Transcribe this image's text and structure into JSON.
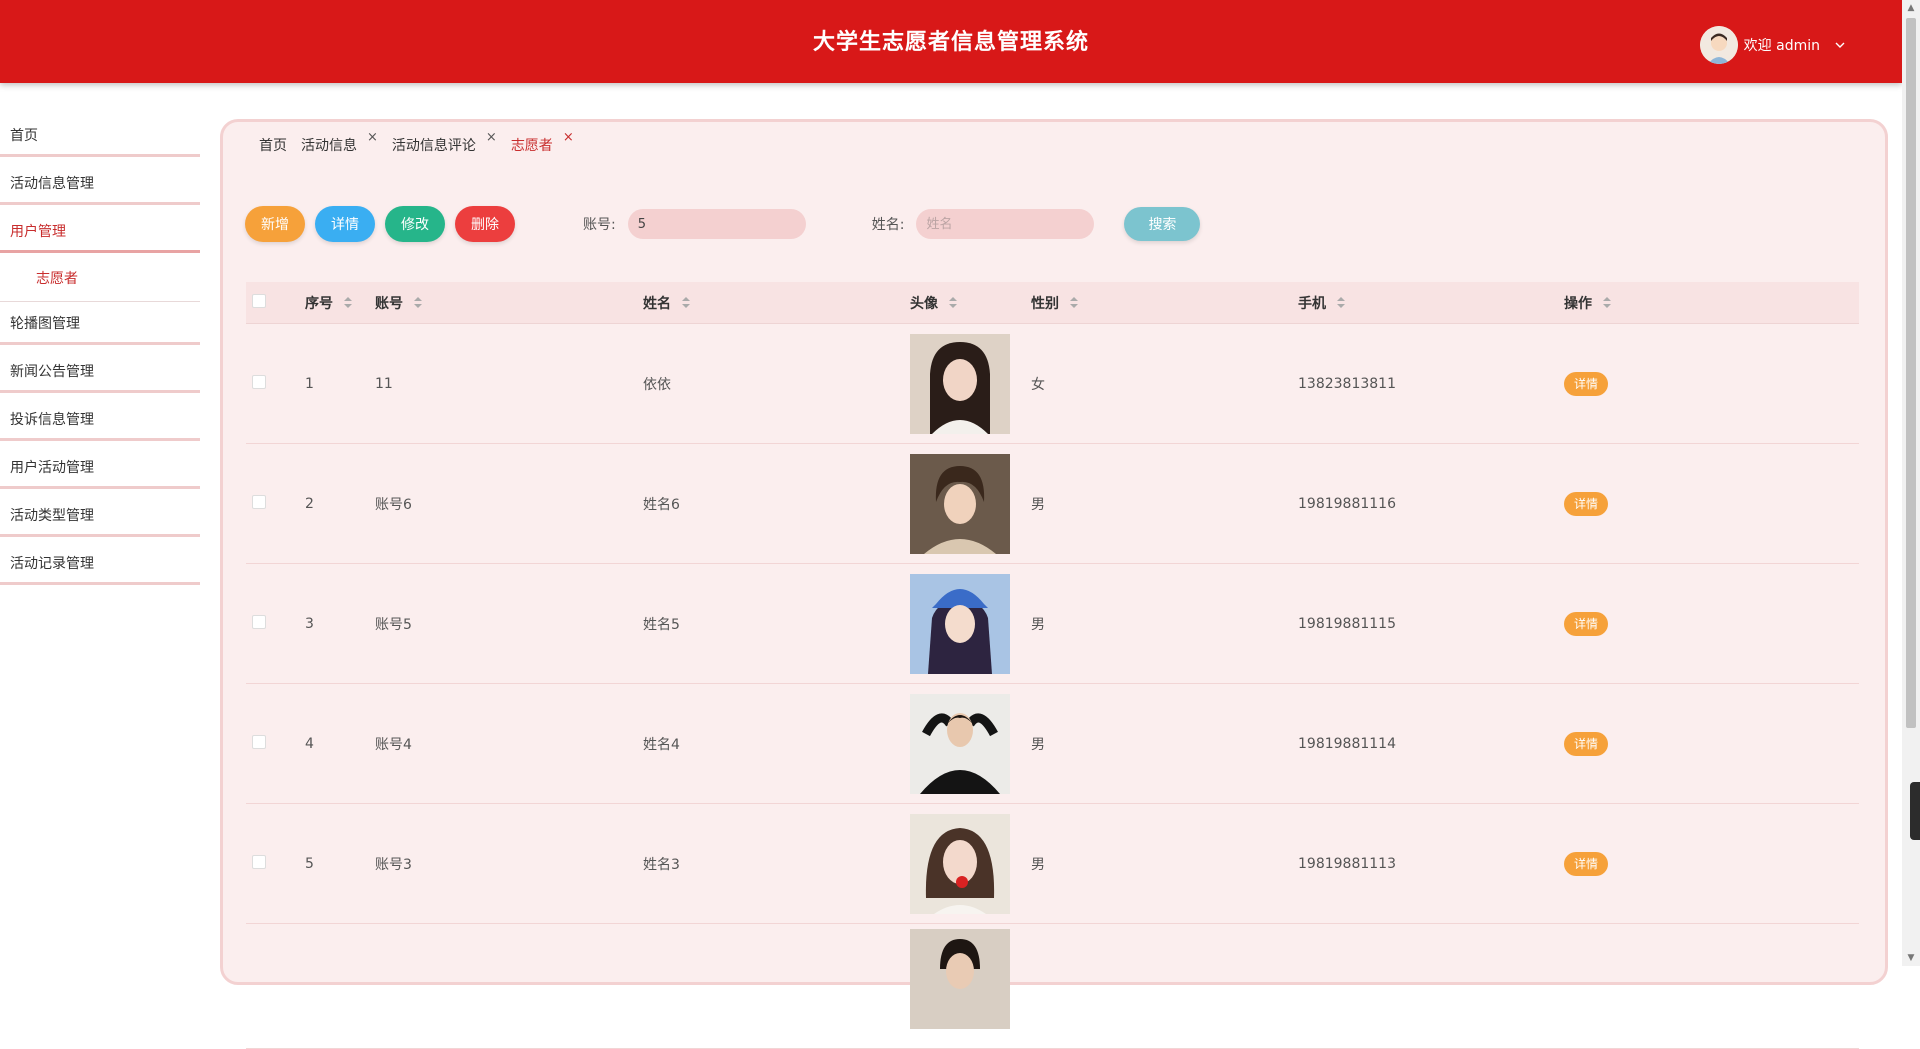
{
  "header": {
    "title": "大学生志愿者信息管理系统",
    "greeting": "欢迎 admin"
  },
  "sidebar": {
    "items": [
      {
        "label": "首页"
      },
      {
        "label": "活动信息管理"
      },
      {
        "label": "用户管理"
      },
      {
        "label": "志愿者"
      },
      {
        "label": "轮播图管理"
      },
      {
        "label": "新闻公告管理"
      },
      {
        "label": "投诉信息管理"
      },
      {
        "label": "用户活动管理"
      },
      {
        "label": "活动类型管理"
      },
      {
        "label": "活动记录管理"
      }
    ]
  },
  "tabs": [
    {
      "label": "首页"
    },
    {
      "label": "活动信息",
      "close": "×"
    },
    {
      "label": "活动信息评论",
      "close": "×"
    },
    {
      "label": "志愿者",
      "close": "×"
    }
  ],
  "toolbar": {
    "add_label": "新增",
    "detail_label": "详情",
    "edit_label": "修改",
    "delete_label": "删除",
    "account_label": "账号:",
    "account_value": "5",
    "name_label": "姓名:",
    "name_placeholder": "姓名",
    "search_label": "搜索"
  },
  "table": {
    "headers": {
      "seq": "序号",
      "account": "账号",
      "name": "姓名",
      "avatar": "头像",
      "gender": "性别",
      "phone": "手机",
      "action": "操作"
    },
    "rows": [
      {
        "seq": "1",
        "account": "11",
        "name": "依依",
        "gender": "女",
        "phone": "13823813811",
        "action": "详情"
      },
      {
        "seq": "2",
        "account": "账号6",
        "name": "姓名6",
        "gender": "男",
        "phone": "19819881116",
        "action": "详情"
      },
      {
        "seq": "3",
        "account": "账号5",
        "name": "姓名5",
        "gender": "男",
        "phone": "19819881115",
        "action": "详情"
      },
      {
        "seq": "4",
        "account": "账号4",
        "name": "姓名4",
        "gender": "男",
        "phone": "19819881114",
        "action": "详情"
      },
      {
        "seq": "5",
        "account": "账号3",
        "name": "姓名3",
        "gender": "男",
        "phone": "19819881113",
        "action": "详情"
      }
    ]
  },
  "colors": {
    "header_bg": "#d81818",
    "panel_bg": "#fbeeee",
    "accent_orange": "#f6a13a",
    "accent_blue": "#3aaef2",
    "accent_green": "#26b58a",
    "accent_red": "#ec3e3e"
  }
}
